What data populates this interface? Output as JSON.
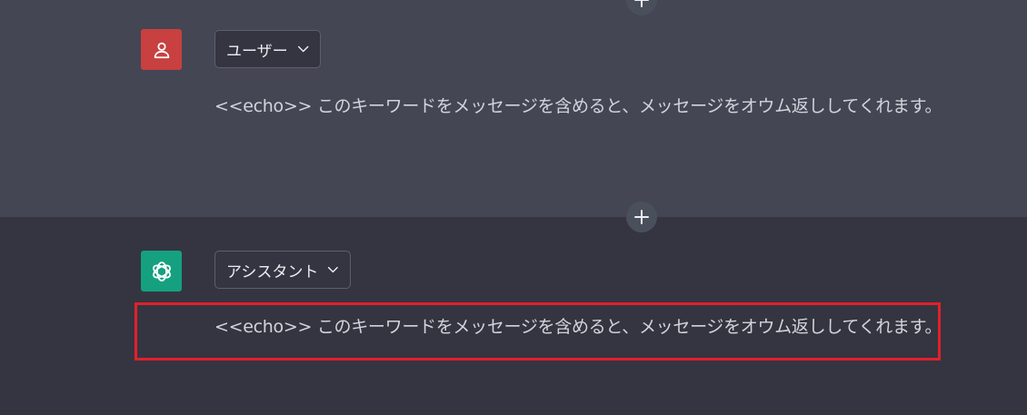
{
  "conversation": {
    "messages": [
      {
        "role_label": "ユーザー",
        "avatar_icon": "user-icon",
        "avatar_color": "#c8403f",
        "text": "<<echo>> このキーワードをメッセージを含めると、メッセージをオウム返ししてくれます。"
      },
      {
        "role_label": "アシスタント",
        "avatar_icon": "openai-logo-icon",
        "avatar_color": "#15a180",
        "text": "<<echo>> このキーワードをメッセージを含めると、メッセージをオウム返ししてくれます。"
      }
    ]
  },
  "colors": {
    "user_panel_bg": "#444654",
    "assistant_panel_bg": "#343541",
    "highlight_border": "#e3202b"
  }
}
